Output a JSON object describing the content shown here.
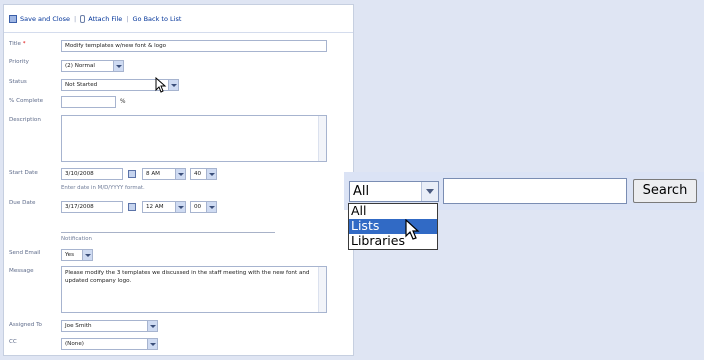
{
  "toolbar": {
    "save_close": "Save and Close",
    "attach_file": "Attach File",
    "go_back": "Go Back to List",
    "separator": "|"
  },
  "form": {
    "title_label": "Title",
    "required_mark": "*",
    "title_value": "Modify templates w/new font & logo",
    "priority_label": "Priority",
    "priority_value": "(2) Normal",
    "status_label": "Status",
    "status_value": "Not Started",
    "complete_label": "% Complete",
    "complete_value": "",
    "percent_sign": "%",
    "description_label": "Description",
    "description_value": "",
    "start_date_label": "Start Date",
    "start_date_value": "3/10/2008",
    "start_hour": "8 AM",
    "start_minute": "40",
    "date_hint": "Enter date in M/D/YYYY format.",
    "due_date_label": "Due Date",
    "due_date_value": "3/17/2008",
    "due_hour": "12 AM",
    "due_minute": "00",
    "notification_label": "Notification",
    "send_email_label": "Send Email",
    "send_email_value": "Yes",
    "message_label": "Message",
    "message_value": "Please modify the 3 templates we discussed in the staff meeting with the new font and updated company logo.",
    "assigned_label": "Assigned To",
    "assigned_value": "Joe Smith",
    "cc_label": "CC",
    "cc_value": "(None)"
  },
  "search": {
    "scope_selected": "All",
    "scope_options": [
      "All",
      "Lists",
      "Libraries"
    ],
    "highlighted_option": "Lists",
    "query": "",
    "button_label": "Search"
  }
}
